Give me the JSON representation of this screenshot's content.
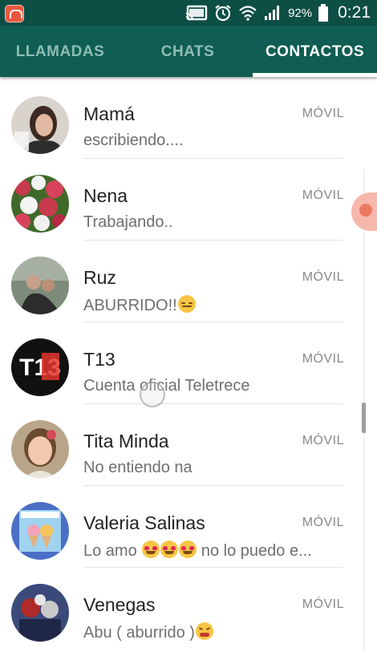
{
  "status_bar": {
    "battery_percent": "92%",
    "time": "0:21",
    "icons": [
      "app-notification-icon",
      "cast-icon",
      "alarm-icon",
      "wifi-icon",
      "signal-icon",
      "battery-icon"
    ]
  },
  "tabs": [
    {
      "label": "LLAMADAS",
      "active": false
    },
    {
      "label": "CHATS",
      "active": false
    },
    {
      "label": "CONTACTOS",
      "active": true
    }
  ],
  "contacts": [
    {
      "name": "Mamá",
      "status": "escribiendo....",
      "type": "MÓVIL",
      "avatar_colors": [
        "#cfc9c3",
        "#3b2a22"
      ]
    },
    {
      "name": "Nena",
      "status": "Trabajando..",
      "type": "MÓVIL",
      "avatar_colors": [
        "#c73a4e",
        "#3f6a2a"
      ]
    },
    {
      "name": "Ruz",
      "status": "ABURRIDO!!",
      "status_emoji": "expressionless-emoji",
      "type": "MÓVIL",
      "avatar_colors": [
        "#6b7a6a",
        "#2c2c2c"
      ]
    },
    {
      "name": "T13",
      "status": "Cuenta oficial Teletrece",
      "type": "MÓVIL",
      "avatar_colors": [
        "#111111",
        "#e2362b"
      ],
      "avatar_text": "T13"
    },
    {
      "name": "Tita Minda",
      "status": "No entiendo na",
      "type": "MÓVIL",
      "avatar_colors": [
        "#b9a58a",
        "#6a4a2f"
      ]
    },
    {
      "name": "Valeria Salinas",
      "status": "Lo amo",
      "status_suffix": "no lo puedo e...",
      "status_emoji": "heart-eyes-emoji",
      "type": "MÓVIL",
      "avatar_colors": [
        "#4a6fc4",
        "#f2a3b8"
      ]
    },
    {
      "name": "Venegas",
      "status": "Abu ( aburrido )",
      "status_emoji": "tired-face-emoji",
      "type": "MÓVIL",
      "avatar_colors": [
        "#3b4a7a",
        "#b02a2a"
      ]
    }
  ]
}
